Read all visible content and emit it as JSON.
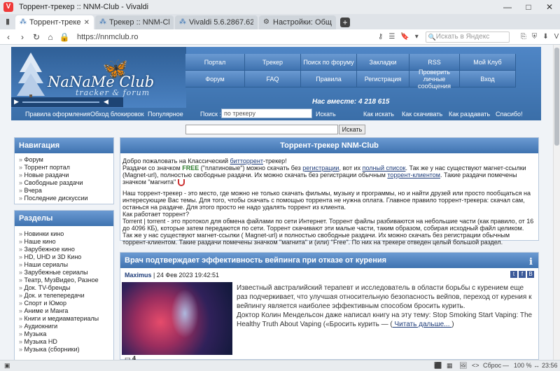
{
  "window": {
    "title": "Торрент-трекер :: NNM-Club - Vivaldi",
    "controls": [
      "—",
      "□",
      "✕"
    ]
  },
  "tabs": [
    {
      "label": "Торрент-трекер :: NNM-C",
      "icon": "nnm-favicon-icon",
      "active": true
    },
    {
      "label": "Трекер :: NNM-Club",
      "icon": "nnm-favicon-icon",
      "active": false
    },
    {
      "label": "Vivaldi 5.6.2867.62 + Авто-",
      "icon": "vivaldi-favicon-icon",
      "active": false
    },
    {
      "label": "Настройки: Общие",
      "icon": "gear-icon",
      "active": false
    }
  ],
  "address": {
    "url": "https://nnmclub.ro",
    "search_placeholder": "Искать в Яндекс"
  },
  "site": {
    "logo": {
      "title": "NaNaMe Club",
      "subtitle": "tracker & forum"
    },
    "menu": {
      "row1": [
        "Портал",
        "Трекер",
        "Поиск по форуму",
        "Закладки",
        "RSS",
        "Мой Клуб"
      ],
      "row2": [
        "Форум",
        "FAQ",
        "Правила",
        "Регистрация",
        "Проверить личные сообщения",
        "Вход"
      ]
    },
    "together": "Нас вместе: 4 218 615",
    "sublinks": [
      "Правила оформления",
      "Обход блокировок",
      "Популярное",
      "Как искать",
      "Как скачивать",
      "Как раздавать",
      "Спасибо!"
    ],
    "tracker_search": {
      "label": "Поиск :",
      "placeholder": "по трекеру",
      "button": "Искать"
    },
    "top_search_button": "Искать"
  },
  "navigation": {
    "title": "Навигация",
    "items": [
      "Форум",
      "Торрент портал",
      "Новые раздачи",
      "Свободные раздачи",
      "Вчера",
      "Последние дискуссии"
    ]
  },
  "sections": {
    "title": "Разделы",
    "items": [
      "Новинки кино",
      "Наше кино",
      "Зарубежное кино",
      "HD, UHD и 3D Кино",
      "Наши сериалы",
      "Зарубежные сериалы",
      "Театр, МузВидео, Разное",
      "Док. TV-бренды",
      "Док. и телепередачи",
      "Спорт и Юмор",
      "Аниме и Манга",
      "Книги и медиаматериалы",
      "Аудиокниги",
      "Музыка",
      "Музыка HD",
      "Музыка (сборники)"
    ]
  },
  "main": {
    "title": "Торрент-трекер NNM-Club",
    "p1_a": "Добро пожаловать на Классический ",
    "p1_link": "битторрент",
    "p1_b": "-трекер!",
    "p2_a": "Раздачи со значком ",
    "p2_free": "FREE",
    "p2_b": " (\"платиновые\") можно скачать без ",
    "p2_link1": "регистрации",
    "p2_c": ", вот их ",
    "p2_link2": "полный список",
    "p2_d": ". Так же у нас существуют магнет-ссылки (Magnet-url), полностью свободные раздачи. Их можно скачать без регистрации обычным ",
    "p2_link3": "торрент-клиентом",
    "p2_e": ". Такие раздачи помечены значком \"магнита\"",
    "p3": "Наш торрент-трекер - это место, где можно не только скачать фильмы, музыку и программы, но и найти друзей или просто пообщаться на интересующие Вас темы. Для того, чтобы скачать с помощью торрента не нужна оплата. Главное правило торрент-трекера: скачал сам, останься на раздаче. Для этого просто не надо удалять торрент из клиента.",
    "p4": "Как работает торрент?",
    "p5": "Torrent | torrent - это протокол для обмена файлами по сети Интернет. Торрент файлы разбиваются на небольшие части (как правило, от 16 до 4096 КБ), которые затем передаются по сети. Торрент скачивают эти малые части, таким образом, собирая исходный файл целиком.",
    "p6": "Так же у нас существуют магнет-ссылки ( Magnet-url) и полностью свободные раздачи. Их можно скачать без регистрации обычным торрент-клиентом. Такие раздачи помечены значком \"магнита\" и (или) \"Free\". По них на трекере отведен целый большой раздел."
  },
  "news": {
    "title": "Врач подтверждает эффективность вейпинга при отказе от курения",
    "author": "Maximus",
    "date": " | 24 Фев 2023 19:42:51",
    "text": "Известный австралийский терапевт и исследователь в области борьбы с курением еще раз подчеркивает, что улучшая относительную безопасность вейпов, переход от курения к вейпингу является наиболее эффективным способом бросить курить.\nДоктор Колин Мендельсон даже написал книгу на эту тему: Stop Smoking Start Vaping: The Healthy Truth About Vaping («Бросить курить — (",
    "readmore": " Читать дальше... ",
    "readmore_tail": ")",
    "comments": "4"
  },
  "statusbar": {
    "reset": "Сброс",
    "zoom": "100 %",
    "time": "23:56"
  }
}
